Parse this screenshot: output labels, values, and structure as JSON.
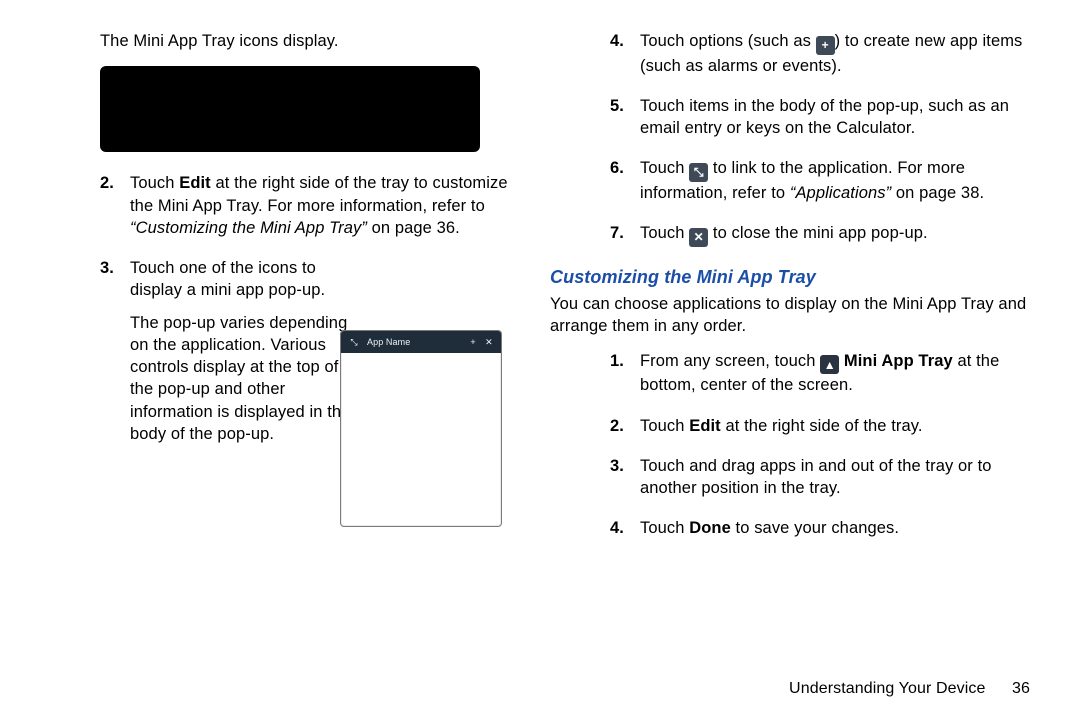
{
  "left": {
    "intro": "The Mini App Tray icons display.",
    "step2_num": "2.",
    "step2_a": "Touch ",
    "step2_edit": "Edit",
    "step2_b": " at the right side of the tray to customize the Mini App Tray. For more information, refer to ",
    "step2_ref": "“Customizing the Mini App Tray”",
    "step2_c": " on page 36.",
    "step3_num": "3.",
    "step3_p1": "Touch one of the icons to display a mini app pop-up.",
    "step3_p2": "The pop-up varies depending on the application. Various controls display at the top of the pop-up and other information is displayed in the body of the pop-up.",
    "popup_title": "App Name"
  },
  "right": {
    "step4_num": "4.",
    "step4_a": "Touch options (such as ",
    "step4_b": ") to create new app items (such as alarms or events).",
    "step5_num": "5.",
    "step5": "Touch items in the body of the pop-up, such as an email entry or keys on the Calculator.",
    "step6_num": "6.",
    "step6_a": "Touch ",
    "step6_b": " to link to the application. For more information, refer to ",
    "step6_ref": "“Applications”",
    "step6_c": " on page 38.",
    "step7_num": "7.",
    "step7_a": "Touch ",
    "step7_b": " to close the mini app pop-up.",
    "heading": "Customizing the Mini App Tray",
    "body": "You can choose applications to display on the Mini App Tray and arrange them in any order.",
    "c1_num": "1.",
    "c1_a": "From any screen, touch ",
    "c1_label": "Mini App Tray",
    "c1_b": " at the bottom, center of the screen.",
    "c2_num": "2.",
    "c2_a": "Touch ",
    "c2_edit": "Edit",
    "c2_b": " at the right side of the tray.",
    "c3_num": "3.",
    "c3": "Touch and drag apps in and out of the tray or to another position in the tray.",
    "c4_num": "4.",
    "c4_a": "Touch ",
    "c4_done": "Done",
    "c4_b": " to save your changes."
  },
  "footer": {
    "section": "Understanding Your Device",
    "page": "36"
  },
  "icons": {
    "plus": "+",
    "diag": "⤡",
    "close": "✕",
    "up": "▲"
  }
}
